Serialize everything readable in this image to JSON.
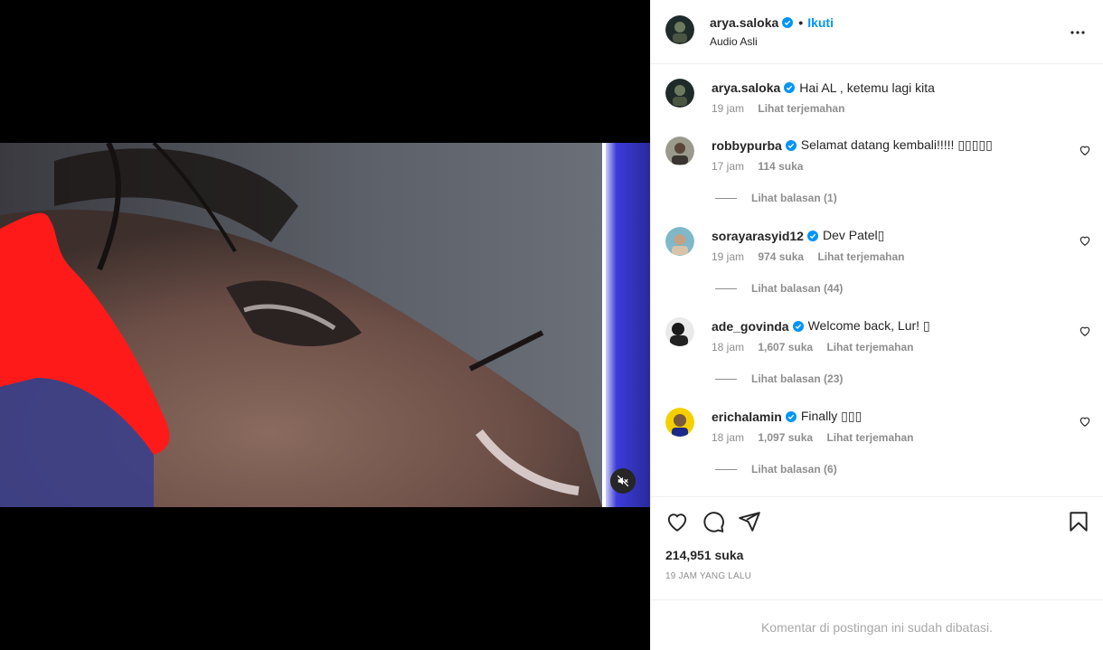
{
  "post": {
    "username": "arya.saloka",
    "follow_label": "Ikuti",
    "dot": "•",
    "audio": "Audio Asli",
    "likes": "214,951 suka",
    "time_ago": "19 JAM YANG LALU",
    "comments_limited": "Komentar di postingan ini sudah dibatasi."
  },
  "caption": {
    "username": "arya.saloka",
    "text": "Hai AL , ketemu lagi kita",
    "time": "19 jam",
    "translate": "Lihat terjemahan"
  },
  "comments": [
    {
      "username": "robbypurba",
      "text": "Selamat datang kembali!!!!! ▯▯▯▯▯",
      "time": "17 jam",
      "likes": "114 suka",
      "translate": "",
      "replies": "Lihat balasan (1)"
    },
    {
      "username": "sorayarasyid12",
      "text": "Dev Patel▯",
      "time": "19 jam",
      "likes": "974 suka",
      "translate": "Lihat terjemahan",
      "replies": "Lihat balasan (44)"
    },
    {
      "username": "ade_govinda",
      "text": "Welcome back, Lur! ▯",
      "time": "18 jam",
      "likes": "1,607 suka",
      "translate": "Lihat terjemahan",
      "replies": "Lihat balasan (23)"
    },
    {
      "username": "erichalamin",
      "text": "Finally ▯▯▯",
      "time": "18 jam",
      "likes": "1,097 suka",
      "translate": "Lihat terjemahan",
      "replies": "Lihat balasan (6)"
    }
  ],
  "colors": {
    "accent": "#0095f6",
    "muted": "#8e8e8e",
    "text": "#262626",
    "verified": "#0095f6"
  },
  "icons": [
    "more-icon",
    "verified-icon",
    "heart-icon",
    "comment-icon",
    "share-icon",
    "bookmark-icon",
    "mute-icon"
  ]
}
